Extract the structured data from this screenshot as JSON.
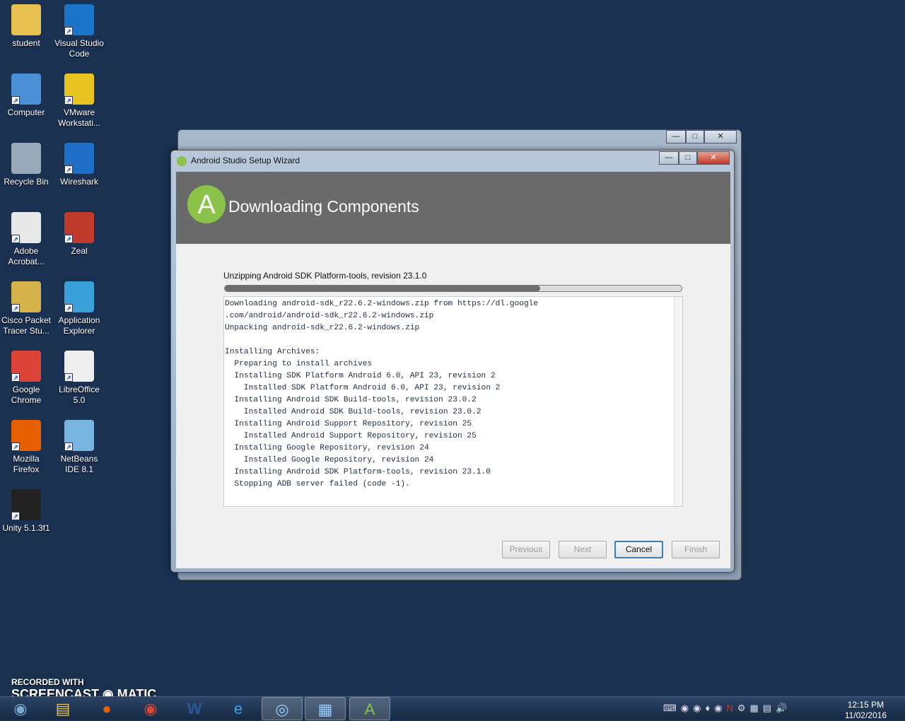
{
  "desktop_icons": [
    {
      "label": "student",
      "color": "#e8c050"
    },
    {
      "label": "Visual Studio Code",
      "color": "#1a75c9"
    },
    {
      "label": "Computer",
      "color": "#4b8fd6"
    },
    {
      "label": "VMware Workstati...",
      "color": "#e8c420"
    },
    {
      "label": "Recycle Bin",
      "color": "#9ab"
    },
    {
      "label": "Wireshark",
      "color": "#1f6fc6"
    },
    {
      "label": "Adobe Acrobat...",
      "color": "#e8e8e8"
    },
    {
      "label": "Zeal",
      "color": "#c0392b"
    },
    {
      "label": "Cisco Packet Tracer Stu...",
      "color": "#d6b24a"
    },
    {
      "label": "Application Explorer",
      "color": "#3aa0d8"
    },
    {
      "label": "Google Chrome",
      "color": "#db4437"
    },
    {
      "label": "LibreOffice 5.0",
      "color": "#eeeeee"
    },
    {
      "label": "Mozilla Firefox",
      "color": "#e66000"
    },
    {
      "label": "NetBeans IDE 8.1",
      "color": "#7ab4e0"
    },
    {
      "label": "Unity 5.1.3f1",
      "color": "#222222"
    }
  ],
  "window": {
    "title": "Android Studio Setup Wizard",
    "heading": "Downloading Components",
    "status": "Unzipping Android SDK Platform-tools, revision 23.1.0",
    "progress_percent": 69,
    "log": [
      "Downloading android-sdk_r22.6.2-windows.zip from https://dl.google",
      ".com/android/android-sdk_r22.6.2-windows.zip",
      "Unpacking android-sdk_r22.6.2-windows.zip",
      "",
      "Installing Archives:",
      "  Preparing to install archives",
      "  Installing SDK Platform Android 6.0, API 23, revision 2",
      "    Installed SDK Platform Android 6.0, API 23, revision 2",
      "  Installing Android SDK Build-tools, revision 23.0.2",
      "    Installed Android SDK Build-tools, revision 23.0.2",
      "  Installing Android Support Repository, revision 25",
      "    Installed Android Support Repository, revision 25",
      "  Installing Google Repository, revision 24",
      "    Installed Google Repository, revision 24",
      "  Installing Android SDK Platform-tools, revision 23.1.0",
      "  Stopping ADB server failed (code -1)."
    ],
    "buttons": {
      "previous": "Previous",
      "next": "Next",
      "cancel": "Cancel",
      "finish": "Finish"
    }
  },
  "watermark": {
    "line1": "RECORDED WITH",
    "line2": "SCREENCAST ◉ MATIC"
  },
  "taskbar": {
    "time": "12:15 PM",
    "date": "11/02/2016"
  }
}
